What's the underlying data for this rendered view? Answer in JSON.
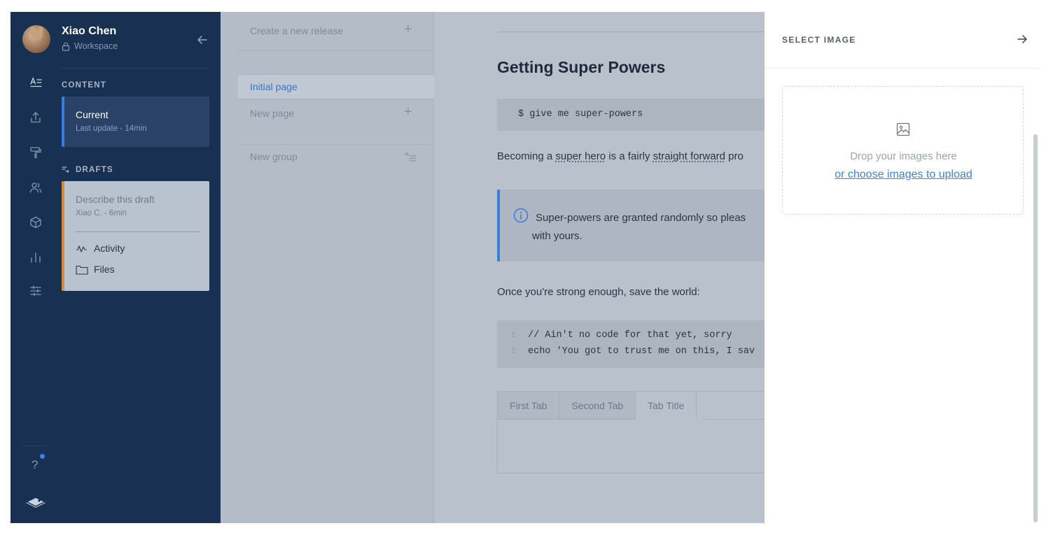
{
  "sidebar": {
    "user_name": "Xiao Chen",
    "workspace_label": "Workspace",
    "content_section": "CONTENT",
    "current_card": {
      "title": "Current",
      "subtitle": "Last update - 14min"
    },
    "drafts_section": "DRAFTS",
    "draft_card": {
      "title": "Describe this draft",
      "subtitle": "Xiao C. - 6min",
      "activity_label": "Activity",
      "files_label": "Files"
    },
    "rail_icons": [
      "content-icon",
      "upload-icon",
      "paint-roller-icon",
      "members-icon",
      "integrations-icon",
      "analytics-icon",
      "settings-sliders-icon"
    ],
    "help_label": "?",
    "notification_color": "#3b82f6"
  },
  "pages": {
    "create_release": "Create a new release",
    "initial_page": "Initial page",
    "new_page": "New page",
    "new_group": "New group"
  },
  "editor": {
    "title": "Getting Super Powers",
    "code_command": "$ give me super-powers",
    "para1_prefix": "Becoming a ",
    "para1_link1": "super hero",
    "para1_middle": " is a fairly ",
    "para1_link2": "straight forward",
    "para1_suffix": " pro",
    "hint_line1": "Super-powers are granted randomly so pleas",
    "hint_line2": "with yours.",
    "para2": "Once you're strong enough, save the world:",
    "code_lines": [
      {
        "num": "1",
        "text": "// Ain't no code for that yet, sorry"
      },
      {
        "num": "2",
        "text": "echo 'You got to trust me on this, I sav"
      }
    ],
    "tabs": [
      "First Tab",
      "Second Tab",
      "Tab Title"
    ]
  },
  "panel": {
    "title": "SELECT IMAGE",
    "drop_text": "Drop your images here",
    "upload_link": "or choose images to upload"
  },
  "colors": {
    "sidebar_bg": "#183051",
    "accent_blue": "#3b7ddd",
    "draft_orange": "#d88a3c",
    "link_blue": "#3b82d6"
  }
}
